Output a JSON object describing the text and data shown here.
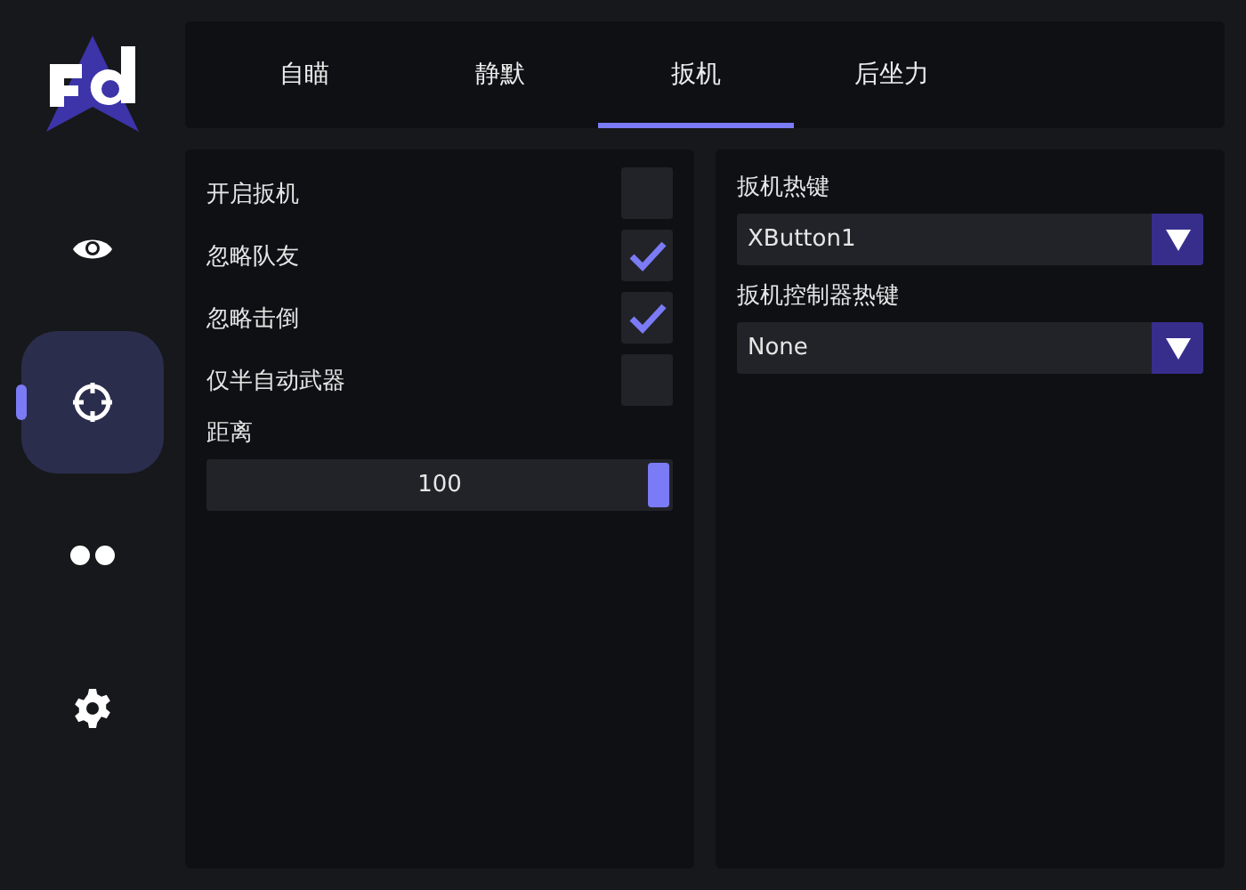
{
  "sidebar": {
    "items": [
      {
        "kind": "eye",
        "selected": false
      },
      {
        "kind": "crosshair",
        "selected": true
      },
      {
        "kind": "dots",
        "selected": false
      },
      {
        "kind": "gear",
        "selected": false
      }
    ]
  },
  "tabs": [
    {
      "label": "自瞄",
      "selected": false
    },
    {
      "label": "静默",
      "selected": false
    },
    {
      "label": "扳机",
      "selected": true
    },
    {
      "label": "后坐力",
      "selected": false
    }
  ],
  "left_panel": {
    "options": [
      {
        "label": "开启扳机",
        "checked": false
      },
      {
        "label": "忽略队友",
        "checked": true
      },
      {
        "label": "忽略击倒",
        "checked": true
      },
      {
        "label": "仅半自动武器",
        "checked": false
      }
    ],
    "distance": {
      "label": "距离",
      "reading": "100",
      "level": 1
    }
  },
  "right_panel": {
    "hotkeys": [
      {
        "label": "扳机热键",
        "value": "XButton1"
      },
      {
        "label": "扳机控制器热键",
        "value": "None"
      }
    ]
  }
}
